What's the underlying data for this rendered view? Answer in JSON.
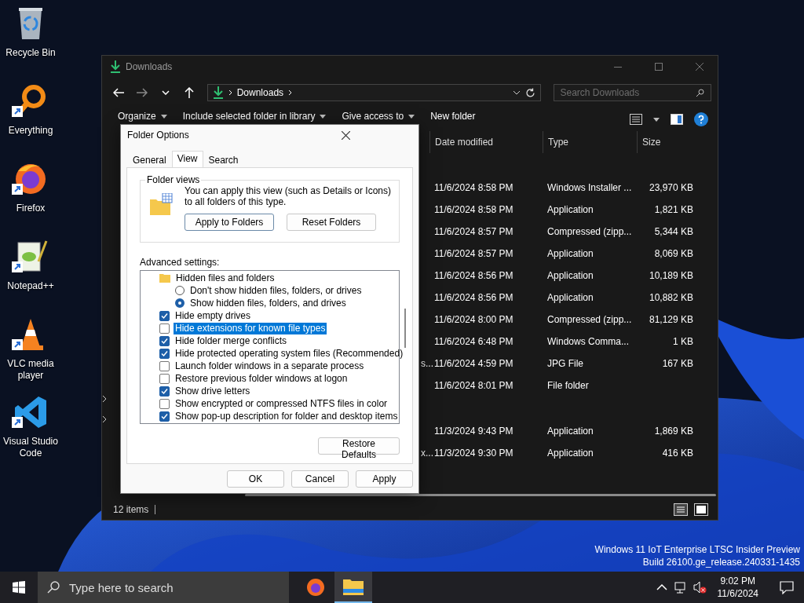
{
  "desktop_icons": [
    {
      "label": "Recycle Bin",
      "kind": "recycle",
      "shortcut": false
    },
    {
      "label": "Everything",
      "kind": "everything",
      "shortcut": true
    },
    {
      "label": "Firefox",
      "kind": "firefox",
      "shortcut": true
    },
    {
      "label": "Notepad++",
      "kind": "notepad",
      "shortcut": true
    },
    {
      "label": "VLC media player",
      "kind": "vlc",
      "shortcut": true
    },
    {
      "label": "Visual Studio Code",
      "kind": "vscode",
      "shortcut": true
    }
  ],
  "explorer": {
    "title": "Downloads",
    "address": "Downloads",
    "search_placeholder": "Search Downloads",
    "commands": [
      {
        "label": "Organize",
        "dropdown": true
      },
      {
        "label": "Include selected folder in library",
        "dropdown": true
      },
      {
        "label": "Give access to",
        "dropdown": true
      },
      {
        "label": "New folder",
        "dropdown": false
      }
    ],
    "columns": [
      "Date modified",
      "Type",
      "Size"
    ],
    "groups": [
      {
        "rows": [
          {
            "date": "11/6/2024 8:58 PM",
            "type": "Windows Installer ...",
            "size": "23,970 KB"
          },
          {
            "date": "11/6/2024 8:58 PM",
            "type": "Application",
            "size": "1,821 KB"
          },
          {
            "date": "11/6/2024 8:57 PM",
            "type": "Compressed (zipp...",
            "size": "5,344 KB"
          },
          {
            "date": "11/6/2024 8:57 PM",
            "type": "Application",
            "size": "8,069 KB"
          },
          {
            "date": "11/6/2024 8:56 PM",
            "type": "Application",
            "size": "10,189 KB"
          },
          {
            "date": "11/6/2024 8:56 PM",
            "type": "Application",
            "size": "10,882 KB"
          },
          {
            "date": "11/6/2024 8:00 PM",
            "type": "Compressed (zipp...",
            "size": "81,129 KB"
          },
          {
            "date": "11/6/2024 6:48 PM",
            "type": "Windows Comma...",
            "size": "1 KB"
          },
          {
            "name": "s...",
            "date": "11/6/2024 4:59 PM",
            "type": "JPG File",
            "size": "167 KB"
          },
          {
            "date": "11/6/2024 8:01 PM",
            "type": "File folder"
          }
        ]
      },
      {
        "rows": [
          {
            "date": "11/3/2024 9:43 PM",
            "type": "Application",
            "size": "1,869 KB"
          },
          {
            "name": "x...",
            "date": "11/3/2024 9:30 PM",
            "type": "Application",
            "size": "416 KB"
          }
        ]
      }
    ],
    "status": "12 items"
  },
  "folder_options": {
    "title": "Folder Options",
    "tabs": [
      {
        "label": "General",
        "selected": false
      },
      {
        "label": "View",
        "selected": true
      },
      {
        "label": "Search",
        "selected": false
      }
    ],
    "folder_views": {
      "legend": "Folder views",
      "text": "You can apply this view (such as Details or Icons) to all folders of this type.",
      "buttons": [
        {
          "label": "Apply to Folders",
          "default": true
        },
        {
          "label": "Reset Folders",
          "default": false
        }
      ]
    },
    "advanced_label": "Advanced settings:",
    "settings": [
      {
        "kind": "folder",
        "label": "Hidden files and folders",
        "selected": false,
        "children": [
          {
            "kind": "radio",
            "label": "Don't show hidden files, folders, or drives",
            "checked": false,
            "selected": false
          },
          {
            "kind": "radio",
            "label": "Show hidden files, folders, and drives",
            "checked": true,
            "selected": false
          }
        ]
      },
      {
        "kind": "checkbox",
        "label": "Hide empty drives",
        "checked": true,
        "selected": false
      },
      {
        "kind": "checkbox",
        "label": "Hide extensions for known file types",
        "checked": false,
        "selected": true
      },
      {
        "kind": "checkbox",
        "label": "Hide folder merge conflicts",
        "checked": true,
        "selected": false
      },
      {
        "kind": "checkbox",
        "label": "Hide protected operating system files (Recommended)",
        "checked": true,
        "selected": false
      },
      {
        "kind": "checkbox",
        "label": "Launch folder windows in a separate process",
        "checked": false,
        "selected": false
      },
      {
        "kind": "checkbox",
        "label": "Restore previous folder windows at logon",
        "checked": false,
        "selected": false
      },
      {
        "kind": "checkbox",
        "label": "Show drive letters",
        "checked": true,
        "selected": false
      },
      {
        "kind": "checkbox",
        "label": "Show encrypted or compressed NTFS files in color",
        "checked": false,
        "selected": false
      },
      {
        "kind": "checkbox",
        "label": "Show pop-up description for folder and desktop items",
        "checked": true,
        "selected": false
      }
    ],
    "restore_button": "Restore Defaults",
    "buttons": [
      "OK",
      "Cancel",
      "Apply"
    ]
  },
  "watermark": [
    "Windows 11 IoT Enterprise LTSC Insider Preview",
    "Build 26100.ge_release.240331-1435"
  ],
  "taskbar": {
    "search_placeholder": "Type here to search",
    "apps": [
      {
        "kind": "firefox",
        "active": false
      },
      {
        "kind": "explorer",
        "active": true
      }
    ],
    "time": "9:02 PM",
    "date": "11/6/2024"
  }
}
